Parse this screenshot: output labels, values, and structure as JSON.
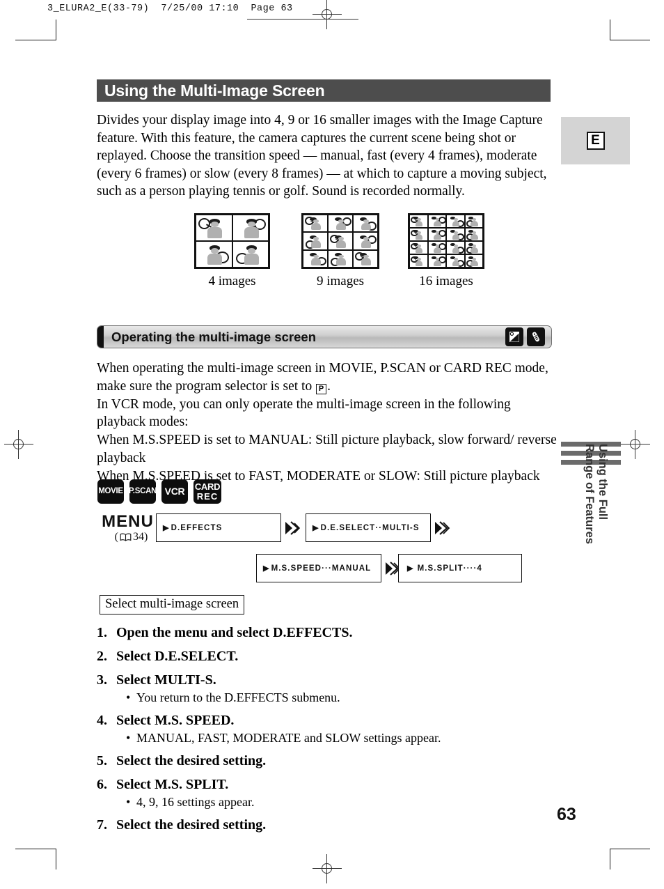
{
  "print_header": {
    "file_line": "3_ELURA2_E(33-79)  7/25/00 17:10  Page 63"
  },
  "language_tab": {
    "label": "E"
  },
  "title": "Using the Multi-Image Screen",
  "intro": "Divides your display image into 4, 9 or 16 smaller images with the Image Capture feature. With this feature, the camera captures the current scene being shot or replayed. Choose the transition speed — manual, fast (every 4 frames), moderate (every 6 frames) or slow (every 8 frames) — at which to capture a moving subject, such as a person playing tennis or golf. Sound is recorded normally.",
  "figures": [
    {
      "caption": "4 images",
      "cols": 2,
      "rows": 2
    },
    {
      "caption": "9 images",
      "cols": 3,
      "rows": 3
    },
    {
      "caption": "16 images",
      "cols": 4,
      "rows": 4
    }
  ],
  "subsection": {
    "title": "Operating the multi-image screen",
    "icons": [
      "lcd-screen-icon",
      "remote-control-icon"
    ]
  },
  "body": {
    "line1_a": "When operating the multi-image screen in MOVIE, P.SCAN or CARD REC mode, make sure the program selector is set to ",
    "program_symbol": "P",
    "line1_b": ".",
    "line2": "In VCR mode, you can only operate the multi-image screen in the following playback modes:",
    "line3": "When M.S.SPEED is set to MANUAL: Still picture playback, slow forward/ reverse playback",
    "line4": "When M.S.SPEED is set to FAST, MODERATE or SLOW: Still picture playback"
  },
  "mode_badges": [
    {
      "name": "movie",
      "lines": [
        "MOVIE"
      ]
    },
    {
      "name": "pscan",
      "lines": [
        "P.SCAN"
      ]
    },
    {
      "name": "vcr",
      "lines": [
        "VCR"
      ]
    },
    {
      "name": "card-rec",
      "lines": [
        "CARD",
        "REC"
      ]
    }
  ],
  "menu_flow": {
    "menu_label": "MENU",
    "menu_ref_open": "(",
    "menu_ref_page": "34",
    "menu_ref_close": ")",
    "boxes": [
      {
        "name": "d-effects",
        "text": "D.EFFECTS"
      },
      {
        "name": "de-select",
        "text": "D.E.SELECT··MULTI-S"
      },
      {
        "name": "ms-speed",
        "text": "M.S.SPEED···MANUAL"
      },
      {
        "name": "ms-split",
        "text": "M.S.SPLIT····4"
      }
    ]
  },
  "callout": "Select multi-image screen",
  "steps": [
    {
      "num": "1.",
      "text": "Open the menu and select D.EFFECTS.",
      "note": null
    },
    {
      "num": "2.",
      "text": "Select D.E.SELECT.",
      "note": null
    },
    {
      "num": "3.",
      "text": "Select MULTI-S.",
      "note": "You return to the D.EFFECTS submenu."
    },
    {
      "num": "4.",
      "text": "Select M.S. SPEED.",
      "note": "MANUAL, FAST, MODERATE and SLOW settings appear."
    },
    {
      "num": "5.",
      "text": "Select the desired setting.",
      "note": null
    },
    {
      "num": "6.",
      "text": "Select M.S. SPLIT.",
      "note": "4, 9, 16 settings appear."
    },
    {
      "num": "7.",
      "text": "Select the desired setting.",
      "note": null
    }
  ],
  "side_tab": {
    "line1": "Using the Full",
    "line2": "Range of Features"
  },
  "page_number": "63"
}
